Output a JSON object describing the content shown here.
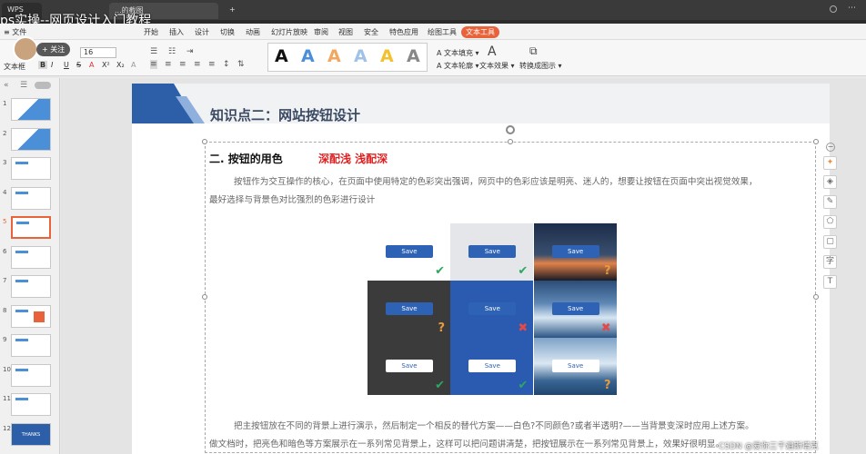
{
  "window": {
    "tabs": [
      {
        "label": "WPS"
      },
      {
        "label": "...的截图"
      },
      {
        "label": "+"
      }
    ],
    "video_title": "ps实操--网页设计入门教程"
  },
  "menu": {
    "file_label": "≡ 文件",
    "items": [
      "开始",
      "插入",
      "设计",
      "切换",
      "动画",
      "幻灯片放映",
      "审阅",
      "视图",
      "安全",
      "特色应用",
      "绘图工具",
      "文本工具"
    ],
    "active_item": "文本工具"
  },
  "ribbon": {
    "text_box_label": "文本框",
    "follow_label": "+ 关注",
    "font_size": "16",
    "format_buttons": [
      "B",
      "I",
      "U",
      "S",
      "A",
      "X²",
      "X₂",
      "A"
    ],
    "fill_label": "A 文本填充 ▾",
    "outline_label": "A 文本轮廓 ▾",
    "effect_label": "文本效果 ▾",
    "convert_label": "转换成图示 ▾"
  },
  "thumbnails": {
    "numbers": [
      "1",
      "2",
      "3",
      "4",
      "5",
      "6",
      "7",
      "8",
      "9",
      "10",
      "11",
      "12"
    ],
    "selected": "5",
    "last_thumb_text": "THANKS"
  },
  "slide": {
    "heading": "知识点二：网站按钮设计",
    "subheading": "二. 按钮的用色",
    "red_text": "深配浅  浅配深",
    "para1_line1": "按钮作为交互操作的核心，在页面中使用特定的色彩突出强调，网页中的色彩应该是明亮、迷人的，想要让按钮在页面中突出视觉效果，",
    "para1_line2": "最好选择与背景色对比强烈的色彩进行设计",
    "para2_line1": "把主按钮放在不同的背景上进行演示，然后制定一个相反的替代方案——白色?不同颜色?或者半透明?——当背景变深时应用上述方案。",
    "para2_line2": "做文档时，把亮色和暗色等方案展示在一系列常见背景上，这样可以把问题讲清楚，把按钮展示在一系列常见背景上，效果好很明显。",
    "save_label": "Save",
    "watermark": "CSDN @爱你三千遍斯塔克"
  },
  "grid": {
    "rows": [
      [
        {
          "bg": "#ffffff",
          "btn": "blue",
          "mark": "check"
        },
        {
          "bg": "#e4e6ea",
          "btn": "blue",
          "mark": "check"
        },
        {
          "bg": "sunset",
          "btn": "blue",
          "mark": "question"
        }
      ],
      [
        {
          "bg": "#3b3b3b",
          "btn": "blue",
          "mark": "question"
        },
        {
          "bg": "#2a5bb0",
          "btn": "blue",
          "mark": "cross"
        },
        {
          "bg": "waves",
          "btn": "blue",
          "mark": "cross"
        }
      ],
      [
        {
          "bg": "#3b3b3b",
          "btn": "white",
          "mark": "check"
        },
        {
          "bg": "#2a5bb0",
          "btn": "white",
          "mark": "check"
        },
        {
          "bg": "waves2",
          "btn": "white",
          "mark": "question"
        }
      ]
    ]
  },
  "colors": {
    "accent_orange": "#e8623a",
    "slide_blue": "#2d5ea8",
    "check_green": "#2aa860",
    "cross_red": "#e24a4a",
    "question_orange": "#e89a3c",
    "heading_red": "#e02020"
  }
}
